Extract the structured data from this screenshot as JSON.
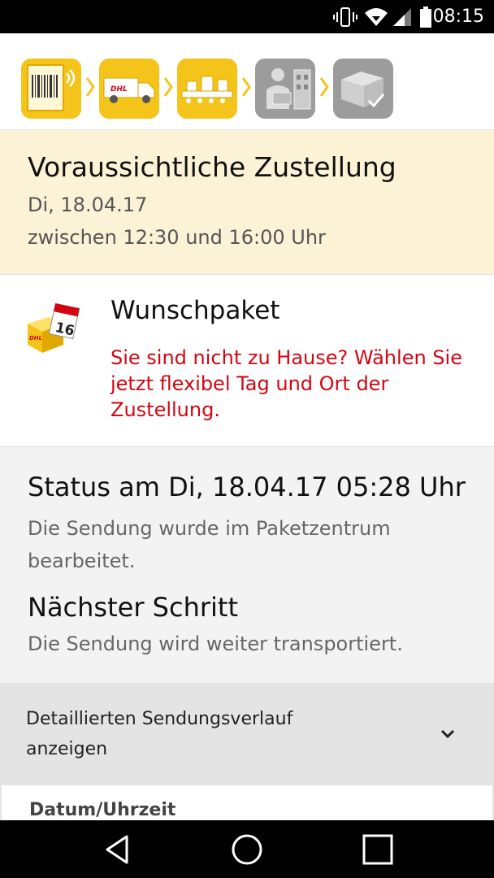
{
  "status_bar": {
    "time": "08:15",
    "icons": [
      "vibrate-icon",
      "wifi-icon",
      "signal-icon",
      "battery-icon"
    ]
  },
  "progress": {
    "steps": [
      {
        "icon": "parcel-label-icon",
        "state": "done"
      },
      {
        "icon": "delivery-truck-icon",
        "state": "done"
      },
      {
        "icon": "parcel-sorting-icon",
        "state": "done"
      },
      {
        "icon": "courier-delivery-icon",
        "state": "pending"
      },
      {
        "icon": "parcel-delivered-icon",
        "state": "pending"
      }
    ],
    "colors": {
      "active": "#f5c41a",
      "inactive": "#9c9c9c"
    }
  },
  "delivery": {
    "title": "Voraussichtliche Zustellung",
    "date": "Di, 18.04.17",
    "window": "zwischen 12:30 und 16:00 Uhr"
  },
  "wunschpaket": {
    "title": "Wunschpaket",
    "text": "Sie sind nicht zu Hause? Wählen Sie jetzt flexibel Tag und Ort der Zustellung."
  },
  "status": {
    "title": "Status am Di, 18.04.17 05:28 Uhr",
    "text": "Die Sendung wurde im Paketzentrum bearbeitet.",
    "next_title": "Nächster Schritt",
    "next_text": "Die Sendung wird weiter transportiert."
  },
  "details": {
    "label": "Detaillierten Sendungsverlauf anzeigen"
  },
  "history_table": {
    "column_date": "Datum/Uhrzeit"
  },
  "nav": [
    "back-icon",
    "home-icon",
    "recents-icon"
  ],
  "colors": {
    "dhl_yellow": "#f5c41a",
    "dhl_red": "#d40511",
    "delivery_bg": "#fcf2d6"
  }
}
